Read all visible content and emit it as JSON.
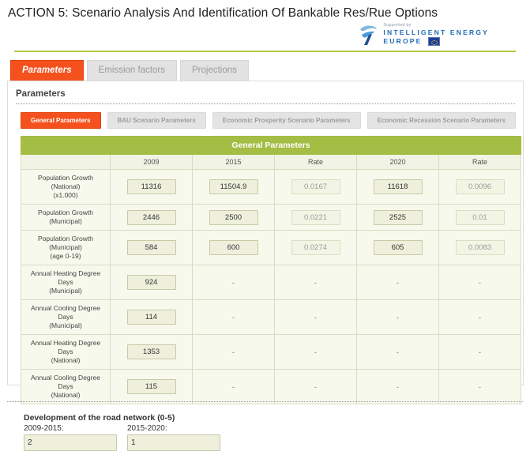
{
  "header": {
    "title": "ACTION 5: Scenario Analysis And Identification Of Bankable Res/Rue Options",
    "logo": {
      "supported_by": "Supported by",
      "line1": "INTELLIGENT ENERGY",
      "line2": "EUROPE"
    }
  },
  "top_tabs": [
    {
      "label": "Parameters",
      "active": true
    },
    {
      "label": "Emission factors",
      "active": false
    },
    {
      "label": "Projections",
      "active": false
    }
  ],
  "panel": {
    "title": "Parameters"
  },
  "sub_tabs": [
    {
      "label": "General Parameters",
      "active": true
    },
    {
      "label": "BAU Scenario Parameters",
      "active": false
    },
    {
      "label": "Economic Prosperity Scenario Parameters",
      "active": false
    },
    {
      "label": "Economic Recession Scenario Parameters",
      "active": false
    }
  ],
  "table": {
    "caption": "General Parameters",
    "columns": [
      "",
      "2009",
      "2015",
      "Rate",
      "2020",
      "Rate"
    ],
    "rows": [
      {
        "label": "Population Growth (National) (x1.000)",
        "label_line1": "Population Growth (National)",
        "label_line2": "(x1.000)",
        "cells": [
          {
            "type": "input",
            "value": "11316",
            "readonly": false
          },
          {
            "type": "input",
            "value": "11504.9",
            "readonly": false
          },
          {
            "type": "input",
            "value": "0.0167",
            "readonly": true
          },
          {
            "type": "input",
            "value": "11618",
            "readonly": false
          },
          {
            "type": "input",
            "value": "0.0096",
            "readonly": true
          }
        ]
      },
      {
        "label": "Population Growth (Municipal)",
        "label_line1": "Population Growth (Municipal)",
        "label_line2": "",
        "cells": [
          {
            "type": "input",
            "value": "2446",
            "readonly": false
          },
          {
            "type": "input",
            "value": "2500",
            "readonly": false
          },
          {
            "type": "input",
            "value": "0.0221",
            "readonly": true
          },
          {
            "type": "input",
            "value": "2525",
            "readonly": false
          },
          {
            "type": "input",
            "value": "0.01",
            "readonly": true
          }
        ]
      },
      {
        "label": "Population Growth (Municipal) (age 0-19)",
        "label_line1": "Population Growth (Municipal)",
        "label_line2": "(age 0-19)",
        "cells": [
          {
            "type": "input",
            "value": "584",
            "readonly": false
          },
          {
            "type": "input",
            "value": "600",
            "readonly": false
          },
          {
            "type": "input",
            "value": "0.0274",
            "readonly": true
          },
          {
            "type": "input",
            "value": "605",
            "readonly": false
          },
          {
            "type": "input",
            "value": "0.0083",
            "readonly": true
          }
        ]
      },
      {
        "label": "Annual Heating Degree Days (Municipal)",
        "label_line1": "Annual Heating Degree Days",
        "label_line2": "(Municipal)",
        "cells": [
          {
            "type": "input",
            "value": "924",
            "readonly": false
          },
          {
            "type": "dash",
            "value": "-"
          },
          {
            "type": "dash",
            "value": "-"
          },
          {
            "type": "dash",
            "value": "-"
          },
          {
            "type": "dash",
            "value": "-"
          }
        ]
      },
      {
        "label": "Annual Cooling Degree Days (Municipal)",
        "label_line1": "Annual Cooling Degree Days",
        "label_line2": "(Municipal)",
        "cells": [
          {
            "type": "input",
            "value": "114",
            "readonly": false
          },
          {
            "type": "dash",
            "value": "-"
          },
          {
            "type": "dash",
            "value": "-"
          },
          {
            "type": "dash",
            "value": "-"
          },
          {
            "type": "dash",
            "value": "-"
          }
        ]
      },
      {
        "label": "Annual Heating Degree Days (National)",
        "label_line1": "Annual Heating Degree Days",
        "label_line2": "(National)",
        "cells": [
          {
            "type": "input",
            "value": "1353",
            "readonly": false
          },
          {
            "type": "dash",
            "value": "-"
          },
          {
            "type": "dash",
            "value": "-"
          },
          {
            "type": "dash",
            "value": "-"
          },
          {
            "type": "dash",
            "value": "-"
          }
        ]
      },
      {
        "label": "Annual Cooling Degree Days (National)",
        "label_line1": "Annual Cooling Degree Days",
        "label_line2": "(National)",
        "cells": [
          {
            "type": "input",
            "value": "115",
            "readonly": false
          },
          {
            "type": "dash",
            "value": "-"
          },
          {
            "type": "dash",
            "value": "-"
          },
          {
            "type": "dash",
            "value": "-"
          },
          {
            "type": "dash",
            "value": "-"
          }
        ]
      }
    ]
  },
  "road_section": {
    "title": "Development of the road network (0-5)",
    "fields": [
      {
        "label": "2009-2015:",
        "value": "2"
      },
      {
        "label": "2015-2020:",
        "value": "1"
      }
    ]
  },
  "colors": {
    "accent_orange": "#f4511e",
    "table_green": "#a4bd44",
    "header_rule": "#b5c93f",
    "input_bg": "#eef0dc",
    "logo_blue": "#1f6cb4"
  }
}
